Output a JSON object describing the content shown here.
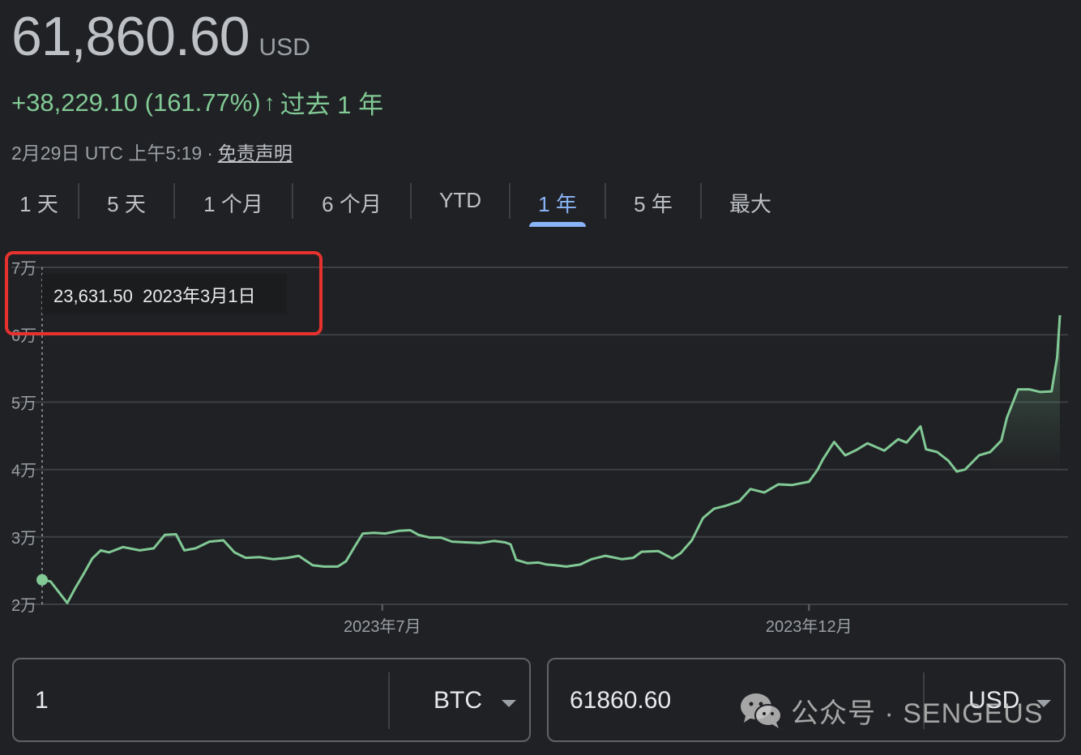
{
  "price": {
    "value": "61,860.60",
    "unit": "USD"
  },
  "change": {
    "text": "+38,229.10 (161.77%)",
    "arrow": "↑",
    "period": "过去 1 年"
  },
  "meta": {
    "timestamp": "2月29日 UTC 上午5:19",
    "separator": "·",
    "disclaimer": "免责声明"
  },
  "tabs": [
    {
      "label": "1 天"
    },
    {
      "label": "5 天"
    },
    {
      "label": "1 个月"
    },
    {
      "label": "6 个月"
    },
    {
      "label": "YTD"
    },
    {
      "label": "1 年",
      "active": true
    },
    {
      "label": "5 年"
    },
    {
      "label": "最大"
    }
  ],
  "tooltip": {
    "value": "23,631.50",
    "date": "2023年3月1日"
  },
  "converter": {
    "left": {
      "value": "1",
      "currency": "BTC"
    },
    "right": {
      "value": "61860.60",
      "currency": "USD"
    }
  },
  "watermark": {
    "icon": "wechat-icon",
    "text": "公众号 · SENGEUS"
  },
  "colors": {
    "line": "#81c995",
    "accent": "#8ab4f8",
    "highlight": "#e5322e",
    "background": "#202124"
  },
  "chart_data": {
    "type": "line",
    "title": "",
    "xlabel": "",
    "ylabel": "",
    "yticks": [
      {
        "value": 70000,
        "label": "7万"
      },
      {
        "value": 60000,
        "label": "6万"
      },
      {
        "value": 50000,
        "label": "5万"
      },
      {
        "value": 40000,
        "label": "4万"
      },
      {
        "value": 30000,
        "label": "3万"
      },
      {
        "value": 20000,
        "label": "2万"
      }
    ],
    "xticks": [
      {
        "x": "2023-07-01",
        "label": "2023年7月"
      },
      {
        "x": "2023-12-01",
        "label": "2023年12月"
      }
    ],
    "ylim": [
      20000,
      70000
    ],
    "xlim": [
      "2023-03-01",
      "2024-02-29"
    ],
    "grid": true,
    "series": [
      {
        "x": [
          "2023-03-01",
          "2023-03-04",
          "2023-03-10",
          "2023-03-13",
          "2023-03-16",
          "2023-03-19",
          "2023-03-22",
          "2023-03-25",
          "2023-03-30",
          "2023-04-05",
          "2023-04-10",
          "2023-04-14",
          "2023-04-18",
          "2023-04-21",
          "2023-04-25",
          "2023-04-30",
          "2023-05-05",
          "2023-05-09",
          "2023-05-13",
          "2023-05-18",
          "2023-05-23",
          "2023-05-28",
          "2023-06-01",
          "2023-06-06",
          "2023-06-10",
          "2023-06-15",
          "2023-06-18",
          "2023-06-21",
          "2023-06-24",
          "2023-06-28",
          "2023-07-02",
          "2023-07-07",
          "2023-07-11",
          "2023-07-14",
          "2023-07-18",
          "2023-07-22",
          "2023-07-26",
          "2023-07-31",
          "2023-08-05",
          "2023-08-10",
          "2023-08-14",
          "2023-08-16",
          "2023-08-18",
          "2023-08-22",
          "2023-08-26",
          "2023-08-29",
          "2023-09-01",
          "2023-09-05",
          "2023-09-10",
          "2023-09-14",
          "2023-09-19",
          "2023-09-25",
          "2023-09-29",
          "2023-10-02",
          "2023-10-08",
          "2023-10-13",
          "2023-10-16",
          "2023-10-20",
          "2023-10-24",
          "2023-10-28",
          "2023-11-01",
          "2023-11-06",
          "2023-11-10",
          "2023-11-15",
          "2023-11-20",
          "2023-11-25",
          "2023-12-01",
          "2023-12-04",
          "2023-12-06",
          "2023-12-10",
          "2023-12-14",
          "2023-12-18",
          "2023-12-22",
          "2023-12-28",
          "2024-01-02",
          "2024-01-05",
          "2024-01-10",
          "2024-01-12",
          "2024-01-16",
          "2024-01-20",
          "2024-01-23",
          "2024-01-26",
          "2024-01-31",
          "2024-02-04",
          "2024-02-08",
          "2024-02-10",
          "2024-02-14",
          "2024-02-18",
          "2024-02-22",
          "2024-02-26",
          "2024-02-28",
          "2024-02-29"
        ],
        "y": [
          23631.5,
          23400,
          20200,
          22500,
          24600,
          26800,
          28000,
          27700,
          28500,
          28000,
          28300,
          30300,
          30400,
          28000,
          28300,
          29300,
          29500,
          27700,
          26900,
          27000,
          26700,
          26900,
          27200,
          25800,
          25600,
          25600,
          26400,
          28500,
          30500,
          30600,
          30500,
          30900,
          31000,
          30300,
          29900,
          29900,
          29300,
          29200,
          29100,
          29400,
          29200,
          28900,
          26600,
          26100,
          26200,
          25900,
          25800,
          25600,
          25900,
          26700,
          27200,
          26700,
          26900,
          27800,
          27900,
          26800,
          27600,
          29500,
          32800,
          34200,
          34600,
          35300,
          37100,
          36600,
          37800,
          37700,
          38200,
          39900,
          41500,
          44100,
          42100,
          42900,
          43900,
          42800,
          44500,
          44000,
          46400,
          43000,
          42600,
          41300,
          39700,
          40000,
          42100,
          42600,
          44300,
          47700,
          51900,
          51900,
          51500,
          51600,
          56700,
          62900
        ]
      }
    ],
    "annotations": [
      {
        "x": "2023-03-01",
        "value": "23,631.50",
        "label": "2023年3月1日"
      }
    ]
  }
}
